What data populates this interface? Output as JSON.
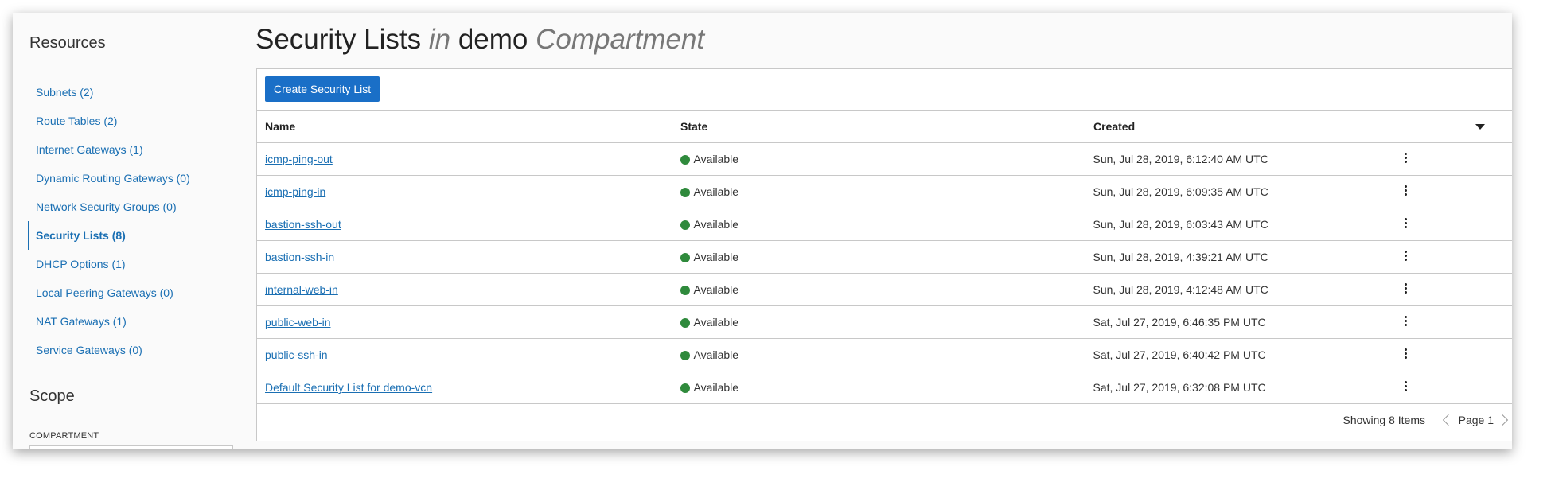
{
  "sidebar": {
    "resources_heading": "Resources",
    "items": [
      {
        "label": "Subnets (2)"
      },
      {
        "label": "Route Tables (2)"
      },
      {
        "label": "Internet Gateways (1)"
      },
      {
        "label": "Dynamic Routing Gateways (0)"
      },
      {
        "label": "Network Security Groups (0)"
      },
      {
        "label": "Security Lists (8)",
        "active": true
      },
      {
        "label": "DHCP Options (1)"
      },
      {
        "label": "Local Peering Gateways (0)"
      },
      {
        "label": "NAT Gateways (1)"
      },
      {
        "label": "Service Gateways (0)"
      }
    ],
    "scope_heading": "Scope",
    "compartment_label": "COMPARTMENT"
  },
  "main": {
    "title_main": "Security Lists",
    "title_in": "in",
    "title_compartment_name": "demo",
    "title_compartment_word": "Compartment"
  },
  "toolbar": {
    "create_label": "Create Security List"
  },
  "table": {
    "headers": {
      "name": "Name",
      "state": "State",
      "created": "Created"
    },
    "rows": [
      {
        "name": "icmp-ping-out",
        "state": "Available",
        "created": "Sun, Jul 28, 2019, 6:12:40 AM UTC"
      },
      {
        "name": "icmp-ping-in",
        "state": "Available",
        "created": "Sun, Jul 28, 2019, 6:09:35 AM UTC"
      },
      {
        "name": "bastion-ssh-out",
        "state": "Available",
        "created": "Sun, Jul 28, 2019, 6:03:43 AM UTC"
      },
      {
        "name": "bastion-ssh-in",
        "state": "Available",
        "created": "Sun, Jul 28, 2019, 4:39:21 AM UTC"
      },
      {
        "name": "internal-web-in",
        "state": "Available",
        "created": "Sun, Jul 28, 2019, 4:12:48 AM UTC"
      },
      {
        "name": "public-web-in",
        "state": "Available",
        "created": "Sat, Jul 27, 2019, 6:46:35 PM UTC"
      },
      {
        "name": "public-ssh-in",
        "state": "Available",
        "created": "Sat, Jul 27, 2019, 6:40:42 PM UTC"
      },
      {
        "name": "Default Security List for demo-vcn",
        "state": "Available",
        "created": "Sat, Jul 27, 2019, 6:32:08 PM UTC"
      }
    ]
  },
  "footer": {
    "showing": "Showing 8 Items",
    "page": "Page 1"
  },
  "colors": {
    "accent": "#1a6fc7",
    "link": "#1a6fb3",
    "available": "#2f8a3c"
  }
}
